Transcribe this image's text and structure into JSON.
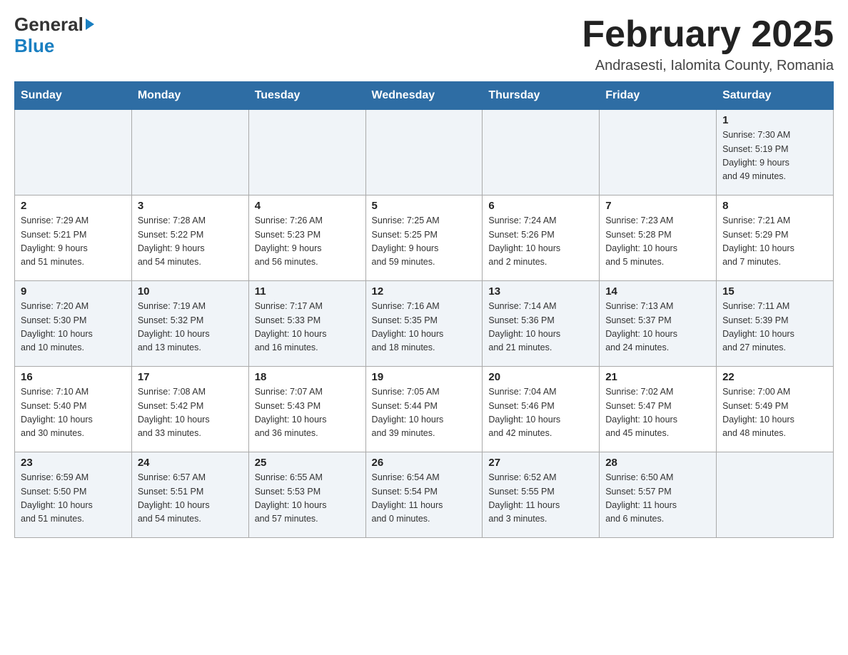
{
  "header": {
    "logo_general": "General",
    "logo_blue": "Blue",
    "title": "February 2025",
    "subtitle": "Andrasesti, Ialomita County, Romania"
  },
  "weekdays": [
    "Sunday",
    "Monday",
    "Tuesday",
    "Wednesday",
    "Thursday",
    "Friday",
    "Saturday"
  ],
  "weeks": [
    [
      {
        "day": "",
        "info": ""
      },
      {
        "day": "",
        "info": ""
      },
      {
        "day": "",
        "info": ""
      },
      {
        "day": "",
        "info": ""
      },
      {
        "day": "",
        "info": ""
      },
      {
        "day": "",
        "info": ""
      },
      {
        "day": "1",
        "info": "Sunrise: 7:30 AM\nSunset: 5:19 PM\nDaylight: 9 hours\nand 49 minutes."
      }
    ],
    [
      {
        "day": "2",
        "info": "Sunrise: 7:29 AM\nSunset: 5:21 PM\nDaylight: 9 hours\nand 51 minutes."
      },
      {
        "day": "3",
        "info": "Sunrise: 7:28 AM\nSunset: 5:22 PM\nDaylight: 9 hours\nand 54 minutes."
      },
      {
        "day": "4",
        "info": "Sunrise: 7:26 AM\nSunset: 5:23 PM\nDaylight: 9 hours\nand 56 minutes."
      },
      {
        "day": "5",
        "info": "Sunrise: 7:25 AM\nSunset: 5:25 PM\nDaylight: 9 hours\nand 59 minutes."
      },
      {
        "day": "6",
        "info": "Sunrise: 7:24 AM\nSunset: 5:26 PM\nDaylight: 10 hours\nand 2 minutes."
      },
      {
        "day": "7",
        "info": "Sunrise: 7:23 AM\nSunset: 5:28 PM\nDaylight: 10 hours\nand 5 minutes."
      },
      {
        "day": "8",
        "info": "Sunrise: 7:21 AM\nSunset: 5:29 PM\nDaylight: 10 hours\nand 7 minutes."
      }
    ],
    [
      {
        "day": "9",
        "info": "Sunrise: 7:20 AM\nSunset: 5:30 PM\nDaylight: 10 hours\nand 10 minutes."
      },
      {
        "day": "10",
        "info": "Sunrise: 7:19 AM\nSunset: 5:32 PM\nDaylight: 10 hours\nand 13 minutes."
      },
      {
        "day": "11",
        "info": "Sunrise: 7:17 AM\nSunset: 5:33 PM\nDaylight: 10 hours\nand 16 minutes."
      },
      {
        "day": "12",
        "info": "Sunrise: 7:16 AM\nSunset: 5:35 PM\nDaylight: 10 hours\nand 18 minutes."
      },
      {
        "day": "13",
        "info": "Sunrise: 7:14 AM\nSunset: 5:36 PM\nDaylight: 10 hours\nand 21 minutes."
      },
      {
        "day": "14",
        "info": "Sunrise: 7:13 AM\nSunset: 5:37 PM\nDaylight: 10 hours\nand 24 minutes."
      },
      {
        "day": "15",
        "info": "Sunrise: 7:11 AM\nSunset: 5:39 PM\nDaylight: 10 hours\nand 27 minutes."
      }
    ],
    [
      {
        "day": "16",
        "info": "Sunrise: 7:10 AM\nSunset: 5:40 PM\nDaylight: 10 hours\nand 30 minutes."
      },
      {
        "day": "17",
        "info": "Sunrise: 7:08 AM\nSunset: 5:42 PM\nDaylight: 10 hours\nand 33 minutes."
      },
      {
        "day": "18",
        "info": "Sunrise: 7:07 AM\nSunset: 5:43 PM\nDaylight: 10 hours\nand 36 minutes."
      },
      {
        "day": "19",
        "info": "Sunrise: 7:05 AM\nSunset: 5:44 PM\nDaylight: 10 hours\nand 39 minutes."
      },
      {
        "day": "20",
        "info": "Sunrise: 7:04 AM\nSunset: 5:46 PM\nDaylight: 10 hours\nand 42 minutes."
      },
      {
        "day": "21",
        "info": "Sunrise: 7:02 AM\nSunset: 5:47 PM\nDaylight: 10 hours\nand 45 minutes."
      },
      {
        "day": "22",
        "info": "Sunrise: 7:00 AM\nSunset: 5:49 PM\nDaylight: 10 hours\nand 48 minutes."
      }
    ],
    [
      {
        "day": "23",
        "info": "Sunrise: 6:59 AM\nSunset: 5:50 PM\nDaylight: 10 hours\nand 51 minutes."
      },
      {
        "day": "24",
        "info": "Sunrise: 6:57 AM\nSunset: 5:51 PM\nDaylight: 10 hours\nand 54 minutes."
      },
      {
        "day": "25",
        "info": "Sunrise: 6:55 AM\nSunset: 5:53 PM\nDaylight: 10 hours\nand 57 minutes."
      },
      {
        "day": "26",
        "info": "Sunrise: 6:54 AM\nSunset: 5:54 PM\nDaylight: 11 hours\nand 0 minutes."
      },
      {
        "day": "27",
        "info": "Sunrise: 6:52 AM\nSunset: 5:55 PM\nDaylight: 11 hours\nand 3 minutes."
      },
      {
        "day": "28",
        "info": "Sunrise: 6:50 AM\nSunset: 5:57 PM\nDaylight: 11 hours\nand 6 minutes."
      },
      {
        "day": "",
        "info": ""
      }
    ]
  ]
}
